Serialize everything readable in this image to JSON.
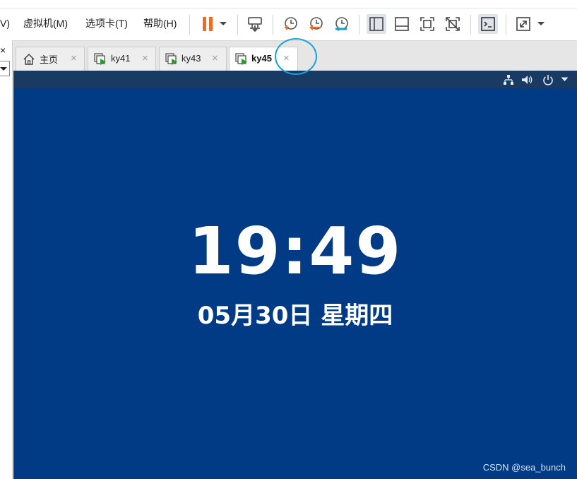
{
  "menu": {
    "view_partial": "V)",
    "vm": "虚拟机(M)",
    "tabs": "选项卡(T)",
    "help": "帮助(H)"
  },
  "toolbar": {
    "icons": [
      "pause-icon",
      "dropdown-arrow-icon",
      "send-ctrl-alt-del-icon",
      "snapshot-icon",
      "revert-snapshot-icon",
      "snapshot-manager-icon",
      "library-view-icon",
      "thumbnail-view-icon",
      "fullscreen-icon",
      "unity-icon",
      "console-view-icon",
      "stretch-icon"
    ],
    "accent_orange": "#f06a1f"
  },
  "left_panel": {
    "close_glyph": "×"
  },
  "tabs": [
    {
      "label": "主页",
      "icon": "home-icon",
      "active": false,
      "close": "×"
    },
    {
      "label": "ky41",
      "icon": "vm-running-icon",
      "active": false,
      "close": "×"
    },
    {
      "label": "ky43",
      "icon": "vm-running-icon",
      "active": false,
      "close": "×"
    },
    {
      "label": "ky45",
      "icon": "vm-running-icon",
      "active": true,
      "close": "×"
    }
  ],
  "vm": {
    "time": "19:49",
    "date": "05月30日 星期四",
    "background": "#013b85",
    "tray_icons": [
      "network-icon",
      "volume-icon",
      "power-icon",
      "dropdown-arrow-icon"
    ]
  },
  "watermark": "CSDN @sea_bunch",
  "highlight_color": "#1aa0d8"
}
